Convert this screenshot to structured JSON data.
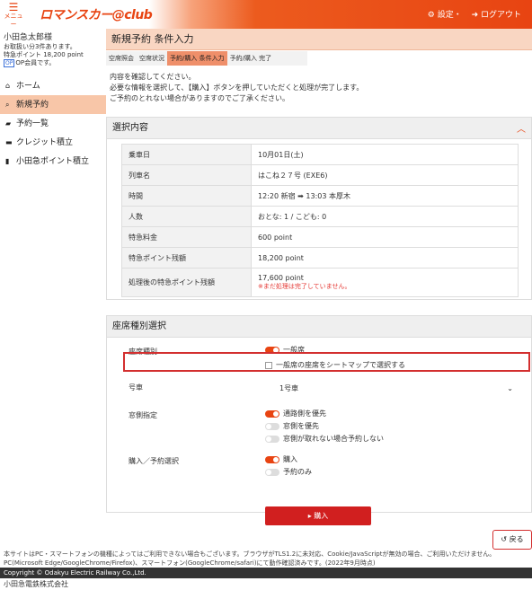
{
  "header": {
    "menu_label": "メニュー",
    "logo_text": "ロマンスカー",
    "logo_club": "@club",
    "settings": "⚙ 設定・",
    "logout": "➜ ログアウト"
  },
  "user": {
    "name": "小田急太郎様",
    "line1": "お取扱い分3件あります。",
    "line2": "特急ポイント 18,200 point",
    "badge": "OP",
    "line3": "OP会員です。"
  },
  "nav": [
    {
      "icon": "⌂",
      "label": "ホーム"
    },
    {
      "icon": "⌕",
      "label": "新規予約"
    },
    {
      "icon": "▰",
      "label": "予約一覧"
    },
    {
      "icon": "▬",
      "label": "クレジット積立"
    },
    {
      "icon": "▮",
      "label": "小田急ポイント積立"
    }
  ],
  "page": {
    "title": "新規予約 条件入力"
  },
  "breadcrumb": [
    "空席照会",
    "空席状況",
    "予約/購入 条件入力",
    "予約/購入 完了"
  ],
  "intro": [
    "内容を確認してください。",
    "必要な情報を選択して、【購入】ボタンを押していただくと処理が完了します。",
    "ご予約のとれない場合がありますのでご了承ください。"
  ],
  "summary": {
    "heading": "選択内容",
    "rows": [
      {
        "k": "乗車日",
        "v": "10月01日(土)"
      },
      {
        "k": "列車名",
        "v": "はこね２７号 (EXE6)"
      },
      {
        "k": "時間",
        "v": "12:20 新宿 ➡ 13:03 本厚木"
      },
      {
        "k": "人数",
        "v": "おとな: 1 / こども: 0"
      },
      {
        "k": "特急料金",
        "v": "600 point"
      },
      {
        "k": "特急ポイント残額",
        "v": "18,200 point"
      },
      {
        "k": "処理後の特急ポイント残額",
        "v": "17,600 point",
        "warn": "※まだ処理は完了していません。"
      }
    ]
  },
  "seat": {
    "heading": "座席種別選択",
    "seat_type_label": "座席種別",
    "seat_opt1": "一般席",
    "seat_opt2": "一般席の座席をシートマップで選択する",
    "car_label": "号車",
    "car_value": "1号車",
    "window_label": "窓側指定",
    "window_opts": [
      "通路側を優先",
      "窓側を優先",
      "窓側が取れない場合予約しない"
    ],
    "purchase_label": "購入／予約選択",
    "purchase_opts": [
      "購入",
      "予約のみ"
    ]
  },
  "buttons": {
    "buy": "▸ 購入",
    "back": "↺ 戻る"
  },
  "footer": {
    "note": "本サイトはPC・スマートフォンの機種によってはご利用できない場合もございます。ブラウザがTLS1.2に未対応、Cookie/JavaScriptが無効の場合、ご利用いただけません。 PC(Microsoft Edge/GoogleChrome/Firefox)、スマートフォン(GoogleChrome/safari)にて動作確認済みです。(2022年9月時点)",
    "copyright": "Copyright © Odakyu Electric Railway Co.,Ltd.",
    "company": "小田急電鉄株式会社"
  },
  "colors": {
    "brand": "#e84412",
    "highlight": "#d32f2f"
  }
}
